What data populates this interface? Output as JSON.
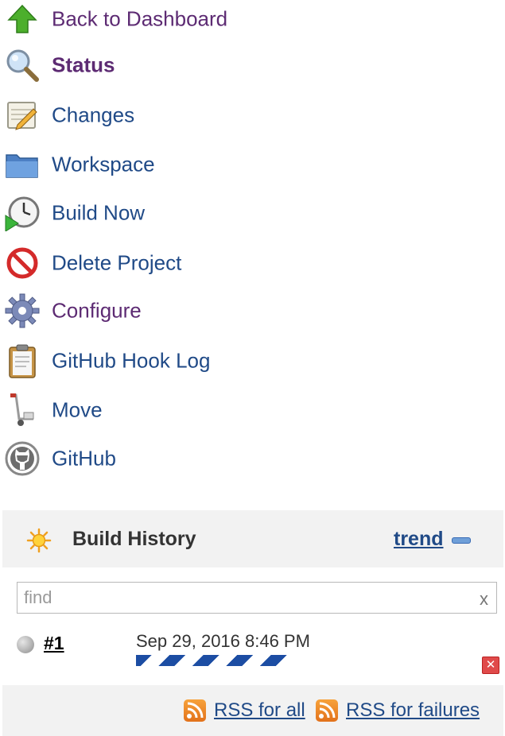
{
  "menu": {
    "items": [
      {
        "label": "Back to Dashboard",
        "icon": "up-arrow-icon"
      },
      {
        "label": "Status",
        "icon": "magnifier-icon"
      },
      {
        "label": "Changes",
        "icon": "notepad-icon"
      },
      {
        "label": "Workspace",
        "icon": "folder-icon"
      },
      {
        "label": "Build Now",
        "icon": "clock-icon"
      },
      {
        "label": "Delete Project",
        "icon": "no-entry-icon"
      },
      {
        "label": "Configure",
        "icon": "gear-icon"
      },
      {
        "label": "GitHub Hook Log",
        "icon": "clipboard-icon"
      },
      {
        "label": "Move",
        "icon": "hand-truck-icon"
      },
      {
        "label": "GitHub",
        "icon": "github-icon"
      }
    ]
  },
  "build_history": {
    "title": "Build History",
    "trend": "trend",
    "find_placeholder": "find",
    "find_clear": "x",
    "builds": [
      {
        "number": "#1",
        "date": "Sep 29, 2016 8:46 PM"
      }
    ],
    "rss_all": "RSS for all",
    "rss_failures": "RSS for failures"
  },
  "colors": {
    "link": "#204a87",
    "visited": "#5d2b73",
    "panel_bg": "#f2f2f2",
    "progress": "#1c4da3"
  }
}
